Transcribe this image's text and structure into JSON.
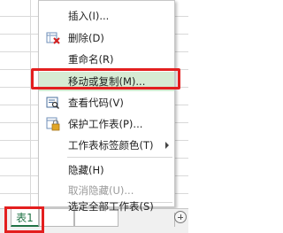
{
  "context_menu": {
    "items": [
      {
        "label": "插入(I)...",
        "icon": "",
        "disabled": false,
        "submenu": false
      },
      {
        "label": "删除(D)",
        "icon": "delete-sheet-icon",
        "disabled": false,
        "submenu": false
      },
      {
        "label": "重命名(R)",
        "icon": "",
        "disabled": false,
        "submenu": false
      },
      {
        "label": "移动或复制(M)...",
        "icon": "",
        "disabled": false,
        "submenu": false,
        "highlighted": true
      },
      {
        "label": "查看代码(V)",
        "icon": "view-code-icon",
        "disabled": false,
        "submenu": false
      },
      {
        "label": "保护工作表(P)...",
        "icon": "protect-sheet-icon",
        "disabled": false,
        "submenu": false
      },
      {
        "label": "工作表标签颜色(T)",
        "icon": "",
        "disabled": false,
        "submenu": true
      },
      {
        "label": "隐藏(H)",
        "icon": "",
        "disabled": false,
        "submenu": false
      },
      {
        "label": "取消隐藏(U)...",
        "icon": "",
        "disabled": true,
        "submenu": false
      },
      {
        "label": "选定全部工作表(S)",
        "icon": "",
        "disabled": false,
        "submenu": false
      }
    ]
  },
  "sheet_tabs": {
    "active_label": "表1",
    "other_labels": [
      "",
      ""
    ]
  },
  "colors": {
    "highlight_box": "#e31f1f",
    "menu_highlight": "#d6ebd3",
    "excel_green": "#217346"
  }
}
